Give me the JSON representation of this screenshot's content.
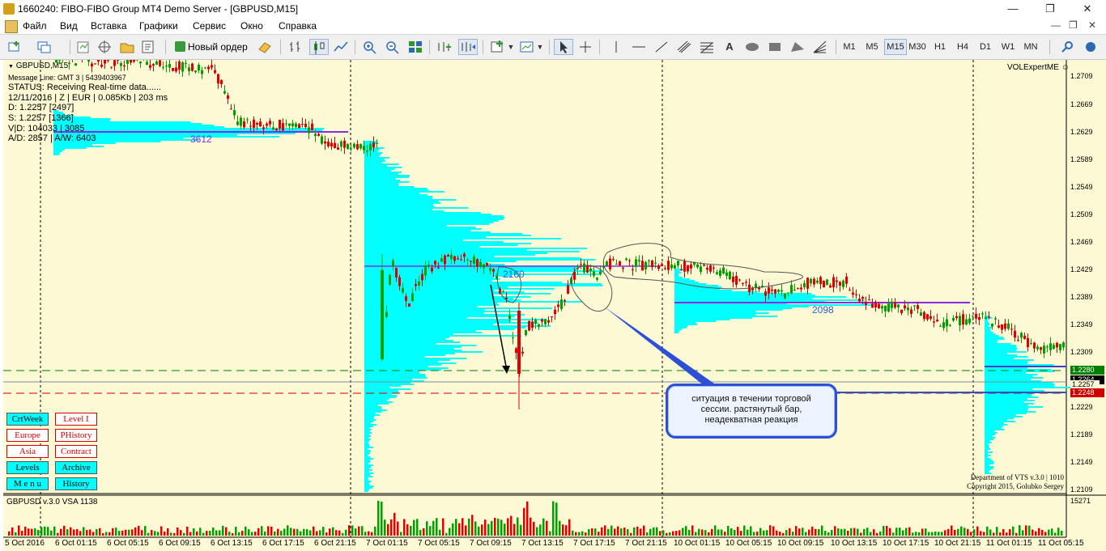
{
  "window": {
    "title": "1660240: FIBO-FIBO Group MT4 Demo Server - [GBPUSD,M15]",
    "minimize": "—",
    "restore": "❐",
    "close": "✕"
  },
  "menu": {
    "items": [
      "Файл",
      "Вид",
      "Вставка",
      "Графики",
      "Сервис",
      "Окно",
      "Справка"
    ],
    "mdi_minimize": "—",
    "mdi_restore": "❐",
    "mdi_close": "✕"
  },
  "toolbar": {
    "new_order_label": "Новый ордер",
    "timeframes": [
      "M1",
      "M5",
      "M15",
      "M30",
      "H1",
      "H4",
      "D1",
      "W1",
      "MN"
    ],
    "active_timeframe": "M15",
    "text_tool": "A",
    "search_icon": "magnifier-icon"
  },
  "chart": {
    "symbol_title": "GBPUSD,M15",
    "expert_name": "VOLExpertME",
    "info": {
      "message_line": "Message Line: GMT 3 | 5439403967",
      "status": "STATUS:  Receiving Real-time data......",
      "date_line": "12/11/2016 | Z | EUR | 0.085Kb | 203 ms",
      "d": "D: 1.2257  [2497]",
      "s": "S: 1.2257  [1366]",
      "vd": "V|D: 104033 | 3085",
      "ad": "A/D: 2857 | A/W: 6403"
    },
    "profile_labels": [
      "3612",
      "2160",
      "2098"
    ],
    "buttons_left": [
      "CrtWeek",
      "Europe",
      "Asia",
      "Levels",
      "M e n u"
    ],
    "buttons_right": [
      "Level I",
      "PHistory",
      "Contract",
      "Archive",
      "History"
    ],
    "copyright": [
      "Department of VTS  v.3.0 | 1010",
      "Copyright 2015, Golubko Sergey"
    ],
    "price_axis": [
      "1.2709",
      "1.2669",
      "1.2629",
      "1.2589",
      "1.2549",
      "1.2509",
      "1.2469",
      "1.2429",
      "1.2389",
      "1.2349",
      "1.2309",
      "1.2229",
      "1.2189",
      "1.2149",
      "1.2109"
    ],
    "price_tags": {
      "green": "1.2280",
      "current": "1.2264",
      "gray": "1.2257",
      "red": "1.2248"
    },
    "indicator_label": "GBPUSD v.3.0 VSA 1138",
    "indicator_max": "15271",
    "time_axis": [
      "5 Oct 2016",
      "6 Oct 01:15",
      "6 Oct 05:15",
      "6 Oct 09:15",
      "6 Oct 13:15",
      "6 Oct 17:15",
      "6 Oct 21:15",
      "7 Oct 01:15",
      "7 Oct 05:15",
      "7 Oct 09:15",
      "7 Oct 13:15",
      "7 Oct 17:15",
      "7 Oct 21:15",
      "10 Oct 01:15",
      "10 Oct 05:15",
      "10 Oct 09:15",
      "10 Oct 13:15",
      "10 Oct 17:15",
      "10 Oct 21:15",
      "11 Oct 01:15",
      "11 Oct 05:15"
    ],
    "callout": [
      "ситуация в течении торговой",
      "сессии. растянутый бар,",
      "неадекватная реакция"
    ],
    "colors": {
      "background": "#fcf9d4",
      "profile": "#00ffff",
      "poc_line": "#8a2be2",
      "bull": "#00a000",
      "bear": "#e00000",
      "green_level": "#008000",
      "red_level": "#d00000"
    }
  }
}
